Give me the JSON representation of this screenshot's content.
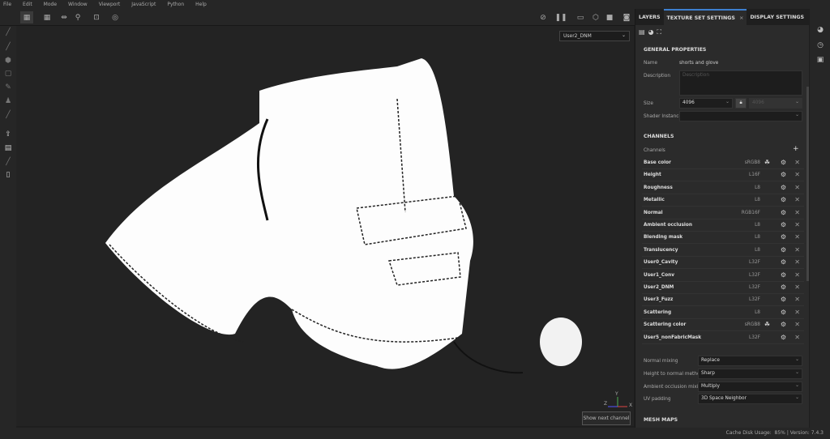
{
  "menu": [
    "File",
    "Edit",
    "Mode",
    "Window",
    "Viewport",
    "JavaScript",
    "Python",
    "Help"
  ],
  "viewport": {
    "channel_select": "User2_DNM",
    "tooltip": "Show next channel",
    "axis": {
      "x": "X",
      "y": "Y",
      "z": "Z"
    }
  },
  "panel": {
    "tabs": [
      "LAYERS",
      "TEXTURE SET SETTINGS",
      "DISPLAY SETTINGS"
    ],
    "tab_close": "×",
    "general": {
      "title": "GENERAL PROPERTIES",
      "name_label": "Name",
      "name_value": "shorts and glove",
      "description_label": "Description",
      "description_placeholder": "Description",
      "size_label": "Size",
      "size_value": "4096",
      "size_locked_value": "4096",
      "shader_label": "Shader Instance",
      "shader_value": ""
    },
    "channels": {
      "title": "CHANNELS",
      "label": "Channels",
      "add": "+",
      "items": [
        {
          "name": "Base color",
          "format": "sRGB8",
          "colorspace": true
        },
        {
          "name": "Height",
          "format": "L16F"
        },
        {
          "name": "Roughness",
          "format": "L8"
        },
        {
          "name": "Metallic",
          "format": "L8"
        },
        {
          "name": "Normal",
          "format": "RGB16F"
        },
        {
          "name": "Ambient occlusion",
          "format": "L8"
        },
        {
          "name": "Blending mask",
          "format": "L8"
        },
        {
          "name": "Translucency",
          "format": "L8"
        },
        {
          "name": "User0_Cavity",
          "format": "L32F"
        },
        {
          "name": "User1_Conv",
          "format": "L32F"
        },
        {
          "name": "User2_DNM",
          "format": "L32F"
        },
        {
          "name": "User3_Fuzz",
          "format": "L32F"
        },
        {
          "name": "Scattering",
          "format": "L8"
        },
        {
          "name": "Scattering color",
          "format": "sRGB8",
          "colorspace": true
        },
        {
          "name": "User5_nonFabricMask",
          "format": "L32F"
        }
      ]
    },
    "mixing": [
      {
        "label": "Normal mixing",
        "value": "Replace"
      },
      {
        "label": "Height to normal method",
        "value": "Sharp"
      },
      {
        "label": "Ambient occlusion mixing",
        "value": "Multiply"
      },
      {
        "label": "UV padding",
        "value": "3D Space Neighbor"
      }
    ],
    "mesh_maps": "MESH MAPS"
  },
  "status": {
    "cache": "Cache Disk Usage:",
    "cache_value": "85%",
    "version": "| Version: 7.4.3"
  },
  "colors": {
    "accent": "#3d7fd0",
    "panel": "#2b2b2b",
    "viewport": "#232323"
  }
}
